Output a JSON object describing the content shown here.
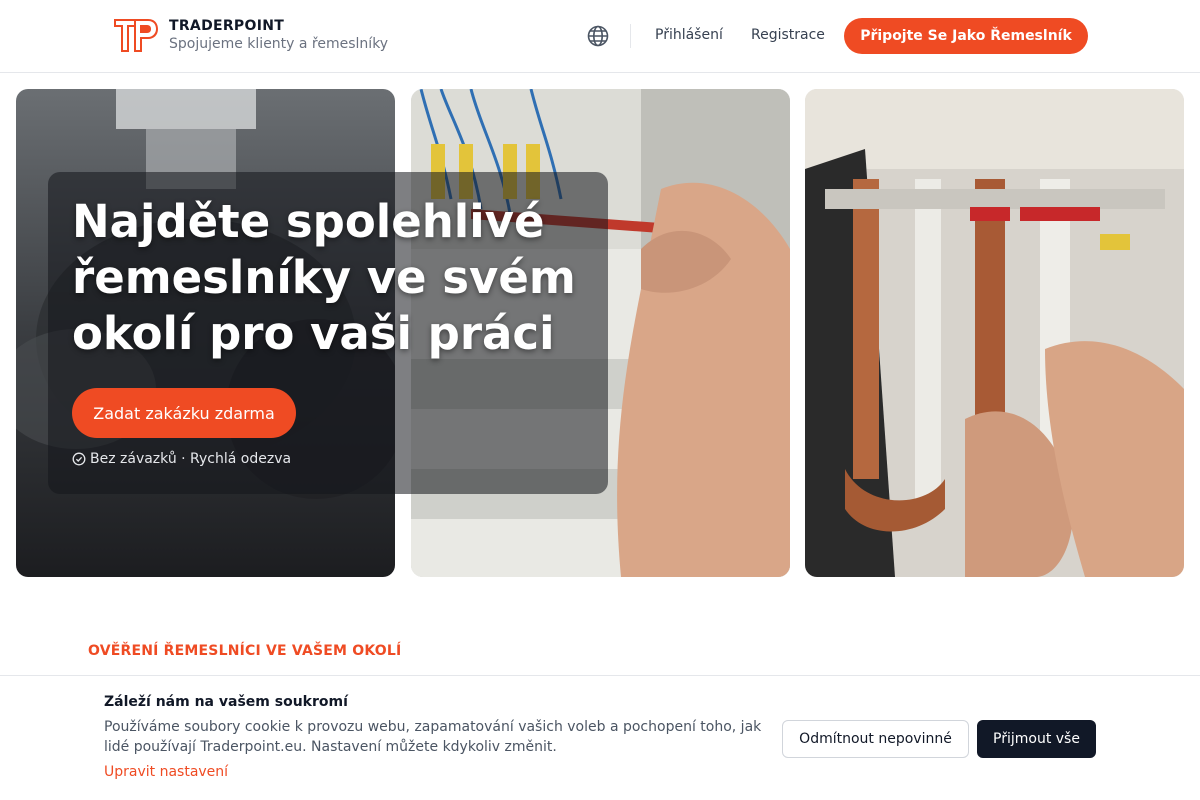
{
  "brand": {
    "name": "TRADERPOINT",
    "tagline": "Spojujeme klienty a řemeslníky",
    "accent_color": "#ef4b23"
  },
  "header": {
    "language_icon": "globe-icon",
    "login_label": "Přihlášení",
    "register_label": "Registrace",
    "join_label": "Připojte Se Jako Řemeslník"
  },
  "hero": {
    "title": "Najděte spolehlivé řemeslníky ve svém okolí pro vaši práci",
    "cta_label": "Zadat zakázku zdarma",
    "note": "Bez závazků · Rychlá odezva"
  },
  "section": {
    "label": "OVĚŘENÍ ŘEMESLNÍCI VE VAŠEM OKOLÍ"
  },
  "cookie": {
    "title": "Záleží nám na vašem soukromí",
    "text": "Používáme soubory cookie k provozu webu, zapamatování vašich voleb a pochopení toho, jak lidé používají Traderpoint.eu. Nastavení můžete kdykoliv změnit.",
    "settings_link": "Upravit nastavení",
    "decline_label": "Odmítnout nepovinné",
    "accept_label": "Přijmout vše"
  }
}
